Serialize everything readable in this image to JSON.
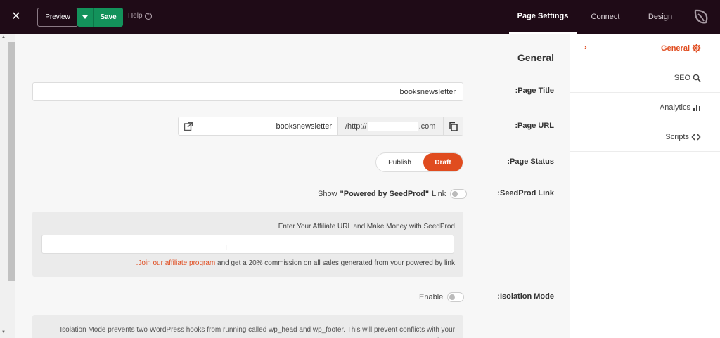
{
  "topbar": {
    "preview_label": "Preview",
    "save_label": "Save",
    "help_label": "Help",
    "tabs": [
      {
        "label": "Page Settings"
      },
      {
        "label": "Connect"
      },
      {
        "label": "Design"
      }
    ]
  },
  "main": {
    "section_title": "General",
    "page_title": {
      "label": ":Page Title",
      "value": "booksnewsletter"
    },
    "page_url": {
      "label": ":Page URL",
      "value": "booksnewsletter",
      "prefix_left": "/http://",
      "prefix_right": ".com"
    },
    "page_status": {
      "label": ":Page Status",
      "publish": "Publish",
      "draft": "Draft",
      "selected": "Draft"
    },
    "seedprod_link": {
      "label": ":SeedProd Link",
      "show": "Show",
      "brand": "\"Powered by SeedProd\"",
      "link": "Link"
    },
    "affiliate": {
      "heading": "Enter Your Affiliate URL and Make Money with SeedProd",
      "link_text": ".Join our affiliate program",
      "note_rest": " and get a 20% commission on all sales generated from your powered by link"
    },
    "isolation": {
      "label": ":Isolation Mode",
      "enable": "Enable",
      "description": "Isolation Mode prevents two WordPress hooks from running called wp_head and wp_footer. This will prevent conflicts with your theme"
    }
  },
  "right_panel": {
    "items": [
      {
        "label": "General",
        "icon": "gear-icon"
      },
      {
        "label": "SEO",
        "icon": "search-icon"
      },
      {
        "label": "Analytics",
        "icon": "bar-chart-icon"
      },
      {
        "label": "Scripts",
        "icon": "code-icon"
      }
    ]
  },
  "colors": {
    "accent": "#e04c1f",
    "save_green": "#13925b",
    "topbar": "#1f0b17"
  }
}
